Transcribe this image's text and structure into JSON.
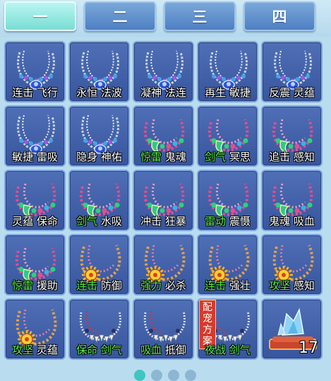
{
  "tabs": [
    {
      "label": "一",
      "active": true
    },
    {
      "label": "二",
      "active": false
    },
    {
      "label": "三",
      "active": false
    },
    {
      "label": "四",
      "active": false
    }
  ],
  "grid": [
    {
      "icon": "silver-necklace-icon",
      "label": [
        {
          "t": "连击",
          "green": false
        },
        {
          "t": " ",
          "green": false
        },
        {
          "t": "飞行",
          "green": false
        }
      ]
    },
    {
      "icon": "silver-necklace-icon",
      "label": [
        {
          "t": "永恒",
          "green": false
        },
        {
          "t": " ",
          "green": false
        },
        {
          "t": "法波",
          "green": false
        }
      ]
    },
    {
      "icon": "silver-necklace-icon",
      "label": [
        {
          "t": "凝神",
          "green": false
        },
        {
          "t": " ",
          "green": false
        },
        {
          "t": "法连",
          "green": false
        }
      ]
    },
    {
      "icon": "silver-necklace-icon",
      "label": [
        {
          "t": "再生",
          "green": false
        },
        {
          "t": " ",
          "green": false
        },
        {
          "t": "敏捷",
          "green": false
        }
      ]
    },
    {
      "icon": "silver-necklace-icon",
      "label": [
        {
          "t": "反震",
          "green": false
        },
        {
          "t": " ",
          "green": false
        },
        {
          "t": "灵蕴",
          "green": false
        }
      ]
    },
    {
      "icon": "silver-necklace-icon",
      "label": [
        {
          "t": "敏捷",
          "green": false
        },
        {
          "t": " ",
          "green": false
        },
        {
          "t": "雷吸",
          "green": false
        }
      ]
    },
    {
      "icon": "silver-necklace-icon",
      "label": [
        {
          "t": "隐身",
          "green": false
        },
        {
          "t": " ",
          "green": false
        },
        {
          "t": "神佑",
          "green": false
        }
      ]
    },
    {
      "icon": "bead-necklace-icon",
      "label": [
        {
          "t": "惊雷",
          "green": true
        },
        {
          "t": " ",
          "green": false
        },
        {
          "t": "鬼魂",
          "green": false
        }
      ]
    },
    {
      "icon": "bead-necklace-icon",
      "label": [
        {
          "t": "剑气",
          "green": true
        },
        {
          "t": " ",
          "green": false
        },
        {
          "t": "冥思",
          "green": false
        }
      ]
    },
    {
      "icon": "bead-necklace-icon",
      "label": [
        {
          "t": "追击",
          "green": false
        },
        {
          "t": " ",
          "green": false
        },
        {
          "t": "感知",
          "green": false
        }
      ]
    },
    {
      "icon": "bead-necklace-icon",
      "label": [
        {
          "t": "灵蕴",
          "green": false
        },
        {
          "t": " ",
          "green": false
        },
        {
          "t": "保命",
          "green": false
        }
      ]
    },
    {
      "icon": "bead-necklace-icon",
      "label": [
        {
          "t": "剑气",
          "green": true
        },
        {
          "t": " ",
          "green": false
        },
        {
          "t": "水吸",
          "green": false
        }
      ]
    },
    {
      "icon": "bead-necklace-icon",
      "label": [
        {
          "t": "冲击",
          "green": false
        },
        {
          "t": " ",
          "green": false
        },
        {
          "t": "狂暴",
          "green": false
        }
      ]
    },
    {
      "icon": "bead-necklace-icon",
      "label": [
        {
          "t": "雷动",
          "green": true
        },
        {
          "t": " ",
          "green": false
        },
        {
          "t": "震慑",
          "green": false
        }
      ]
    },
    {
      "icon": "bead-necklace-icon",
      "label": [
        {
          "t": "鬼魂",
          "green": false
        },
        {
          "t": " ",
          "green": false
        },
        {
          "t": "吸血",
          "green": false
        }
      ]
    },
    {
      "icon": "bead-necklace-icon",
      "label": [
        {
          "t": "惊雷",
          "green": true
        },
        {
          "t": " ",
          "green": false
        },
        {
          "t": "援助",
          "green": false
        }
      ]
    },
    {
      "icon": "sun-necklace-icon",
      "label": [
        {
          "t": "连击",
          "green": true
        },
        {
          "t": " ",
          "green": false
        },
        {
          "t": "防御",
          "green": false
        }
      ]
    },
    {
      "icon": "sun-necklace-icon",
      "label": [
        {
          "t": "强力",
          "green": true
        },
        {
          "t": " ",
          "green": false
        },
        {
          "t": "必杀",
          "green": false
        }
      ]
    },
    {
      "icon": "sun-necklace-icon",
      "label": [
        {
          "t": "连击",
          "green": true
        },
        {
          "t": " ",
          "green": false
        },
        {
          "t": "强壮",
          "green": false
        }
      ]
    },
    {
      "icon": "sun-necklace-icon",
      "label": [
        {
          "t": "攻坚",
          "green": true
        },
        {
          "t": " ",
          "green": false
        },
        {
          "t": "感知",
          "green": false
        }
      ]
    },
    {
      "icon": "sun-necklace-icon",
      "label": [
        {
          "t": "攻坚",
          "green": true
        },
        {
          "t": " ",
          "green": false
        },
        {
          "t": "灵蕴",
          "green": false
        }
      ]
    },
    {
      "icon": "tooth-necklace-icon",
      "label": [
        {
          "t": "保命",
          "green": true
        },
        {
          "t": " ",
          "green": false
        },
        {
          "t": "剑气",
          "green": true
        }
      ]
    },
    {
      "icon": "tooth-necklace-icon",
      "label": [
        {
          "t": "吸血",
          "green": true
        },
        {
          "t": " ",
          "green": false
        },
        {
          "t": "抵御",
          "green": false
        }
      ]
    },
    {
      "icon": "tooth-necklace-icon",
      "badge": "配宠方案",
      "label": [
        {
          "t": "夜战",
          "green": true
        },
        {
          "t": " ",
          "green": false
        },
        {
          "t": "剑气",
          "green": true
        }
      ]
    },
    {
      "icon": "crystal-cushion-icon",
      "count": "17",
      "label": []
    }
  ],
  "pager": {
    "pages": 4,
    "current": 1
  },
  "colors": {
    "accent_green": "#5bf04a",
    "tab_active": "#79ddd3",
    "cell_bg": "#3f5ea6",
    "badge": "#d63a2a"
  }
}
